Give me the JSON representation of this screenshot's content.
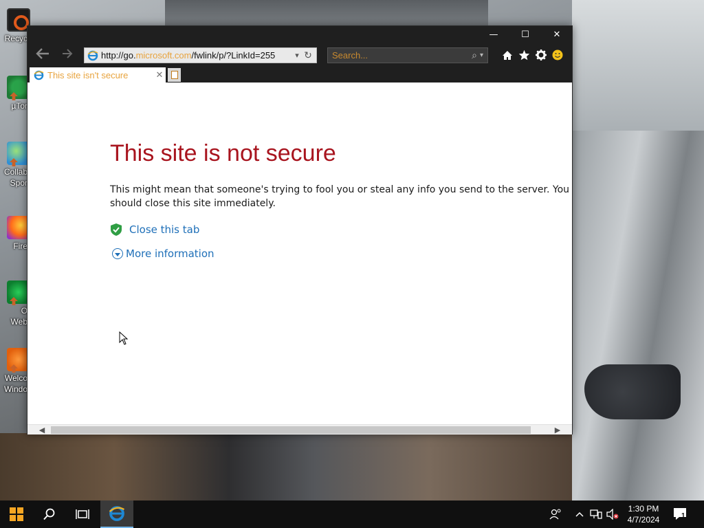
{
  "desktop": {
    "icons": [
      {
        "label": "Recyc",
        "icon": "recycle-bin-icon"
      },
      {
        "label": "µTor",
        "icon": "utorrent-icon"
      },
      {
        "label": "Collab",
        "label2": "Spor",
        "icon": "collaboration-icon"
      },
      {
        "label": "Fire",
        "icon": "firefox-icon"
      },
      {
        "label": "O",
        "label2": "Web",
        "icon": "opera-icon"
      },
      {
        "label": "Welco",
        "label2": "Windo",
        "icon": "welcome-icon"
      }
    ]
  },
  "window": {
    "address": {
      "prefix": "http://go.",
      "domain": "microsoft.com",
      "path": "/fwlink/p/?LinkId=255"
    },
    "search_placeholder": "Search...",
    "tab": {
      "label": "This site isn't secure"
    },
    "caption": {
      "minimize": "—",
      "maximize": "☐",
      "close": "✕"
    }
  },
  "page": {
    "title": "This site is not secure",
    "body": "This might mean that someone's trying to fool you or steal any info you send to the server. You should close this site immediately.",
    "close_tab_link": "Close this tab",
    "more_info_link": "More information"
  },
  "taskbar": {
    "time": "1:30 PM",
    "date": "4/7/2024",
    "notification_count": "1"
  },
  "colors": {
    "error_title": "#a8141e",
    "link": "#1e6fb8",
    "url_highlight": "#e8a33d",
    "shield": "#2f9e44"
  }
}
